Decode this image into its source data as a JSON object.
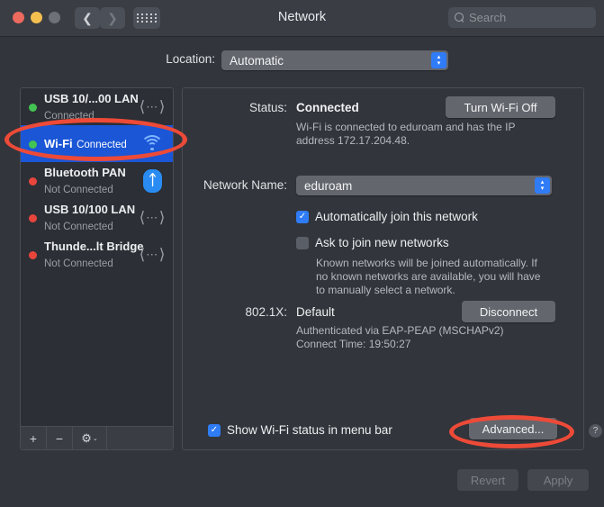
{
  "window": {
    "title": "Network",
    "traffic_lights": [
      "close",
      "minimize",
      "zoom"
    ],
    "nav_back_icon": "chevron-left-icon",
    "nav_forward_icon": "chevron-right-icon",
    "grid_icon": "grid-apps-icon"
  },
  "search": {
    "placeholder": "Search",
    "value": "",
    "icon": "search-icon"
  },
  "location": {
    "label": "Location:",
    "value": "Automatic",
    "options": [
      "Automatic"
    ]
  },
  "sidebar": {
    "services": [
      {
        "name": "USB 10/...00 LAN",
        "status": "Connected",
        "dot": "green",
        "icon": "ethernet-icon",
        "selected": false
      },
      {
        "name": "Wi-Fi",
        "status": "Connected",
        "dot": "green",
        "icon": "wifi-icon",
        "selected": true
      },
      {
        "name": "Bluetooth PAN",
        "status": "Not Connected",
        "dot": "red",
        "icon": "bluetooth-icon",
        "selected": false
      },
      {
        "name": "USB 10/100 LAN",
        "status": "Not Connected",
        "dot": "red",
        "icon": "ethernet-icon",
        "selected": false
      },
      {
        "name": "Thunde...lt Bridge",
        "status": "Not Connected",
        "dot": "red",
        "icon": "ethernet-icon",
        "selected": false
      }
    ],
    "toolbar": {
      "add_label": "+",
      "remove_label": "−",
      "gear_label": "⚙",
      "gear_caret": "⌄",
      "add_icon": "plus-icon",
      "remove_icon": "minus-icon",
      "gear_icon": "gear-icon"
    }
  },
  "panel": {
    "status_label": "Status:",
    "status_value": "Connected",
    "status_description": "Wi-Fi is connected to eduroam and has the IP address 172.17.204.48.",
    "turn_wifi_off_label": "Turn Wi-Fi Off",
    "network_name_label": "Network Name:",
    "network_name_value": "eduroam",
    "auto_join_label": "Automatically join this network",
    "auto_join_checked": true,
    "ask_join_label": "Ask to join new networks",
    "ask_join_checked": false,
    "ask_join_help": "Known networks will be joined automatically. If no known networks are available, you will have to manually select a network.",
    "dot1x_label": "802.1X:",
    "dot1x_value": "Default",
    "disconnect_label": "Disconnect",
    "dot1x_description": "Authenticated via EAP-PEAP (MSCHAPv2)\nConnect Time: 19:50:27",
    "dot1x_auth_line": "Authenticated via EAP-PEAP (MSCHAPv2)",
    "dot1x_time_line": "Connect Time: 19:50:27",
    "show_status_label": "Show Wi-Fi status in menu bar",
    "show_status_checked": true,
    "advanced_label": "Advanced...",
    "help_label": "?",
    "checkmark": "✓"
  },
  "footer": {
    "revert_label": "Revert",
    "apply_label": "Apply",
    "revert_enabled": false,
    "apply_enabled": false
  },
  "stepper_glyphs": {
    "up": "▴",
    "down": "▾"
  },
  "annotations": {
    "color": "#ed4a38",
    "highlights": [
      "wifi-service-row",
      "advanced-button"
    ]
  }
}
